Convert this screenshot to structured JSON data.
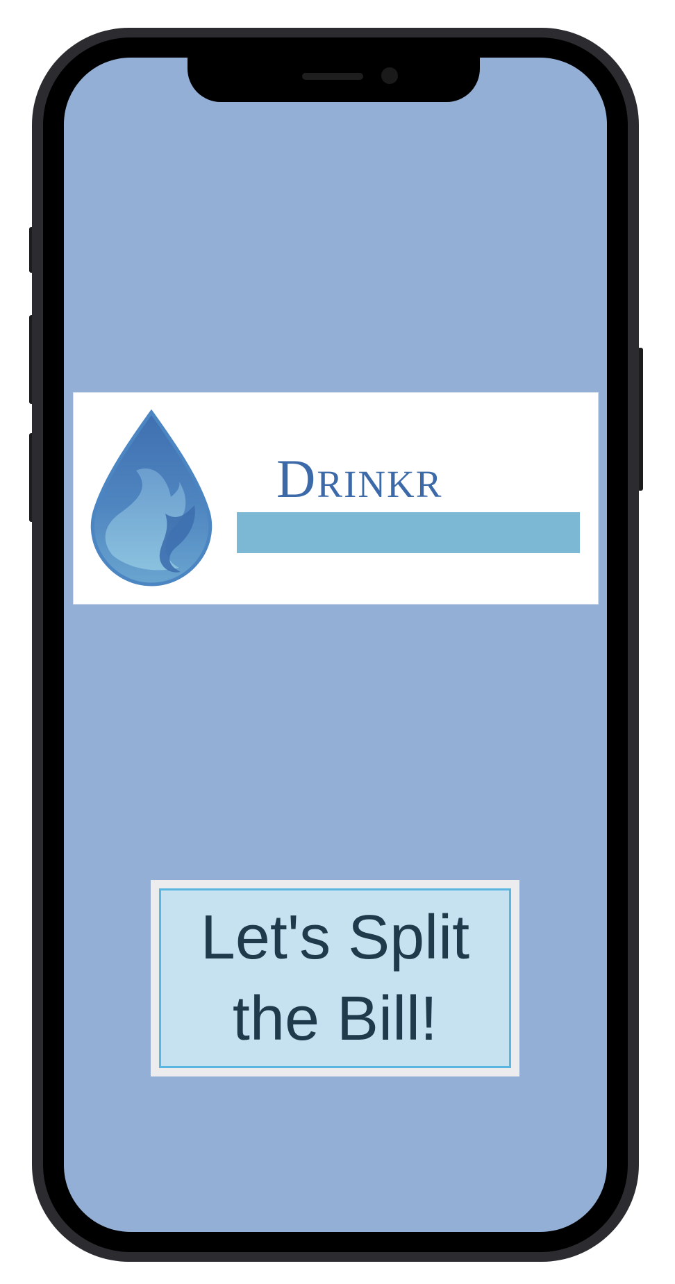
{
  "app": {
    "brand": {
      "name": "Drinkr",
      "logo_icon": "water-drop-icon",
      "accent_bar_color": "#7cb7d4",
      "text_color": "#3c69a8"
    },
    "screen_background": "#93afd5",
    "split_button": {
      "label": "Let's Split the Bill!",
      "background": "#c6e2f0",
      "border_color": "#59b6e0",
      "text_color": "#1f3a4b"
    }
  }
}
